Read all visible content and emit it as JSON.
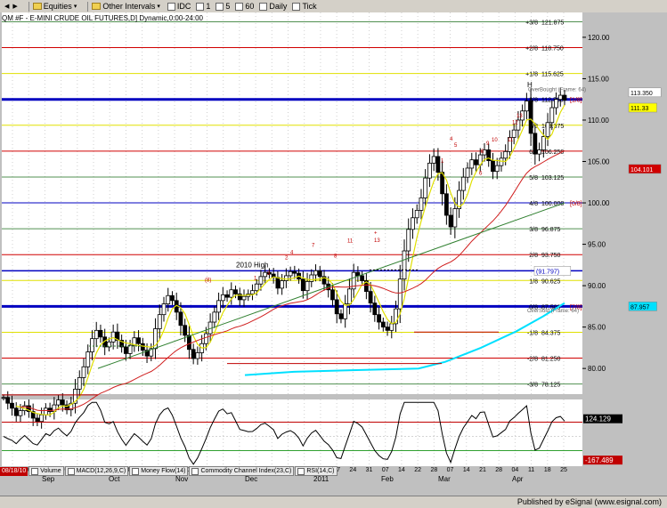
{
  "toolbar": {
    "items": [
      "Equities",
      "Other Intervals",
      "IDC",
      "1",
      "5",
      "60",
      "Daily",
      "Tick"
    ]
  },
  "chart_title": "QM #F - E-MINI CRUDE OIL FUTURES,D] Dynamic,0:00-24:00",
  "colors": {
    "background": "#ffffff",
    "axis_panel": "#c0c0c0",
    "up_bar": "#000000",
    "down_bar": "#000000",
    "ma_yellow": "#e0e000",
    "ma_red": "#d02020",
    "ma_green": "#308030",
    "ma_cyan": "#00e0ff",
    "murray_red": "#d00000",
    "murray_blue": "#0000c0",
    "murray_yellow": "#e0e000",
    "murray_green": "#509050"
  },
  "chart_data": [
    {
      "type": "line",
      "title": "",
      "ylim": [
        76.9,
        123
      ],
      "y_ticks": [
        80.0,
        85.0,
        90.0,
        95.0,
        100.0,
        105.0,
        110.0,
        115.0,
        120.0
      ],
      "x_months": [
        "Sep",
        "Oct",
        "Nov",
        "Dec",
        "2011",
        "Feb",
        "Mar",
        "Apr"
      ],
      "x_ticks": [
        "30",
        "07",
        "13",
        "20",
        "27",
        "04",
        "11",
        "18",
        "25",
        "01",
        "08",
        "15",
        "22",
        "29",
        "06",
        "13",
        "20",
        "27",
        "03",
        "10",
        "17",
        "24",
        "31",
        "07",
        "14",
        "22",
        "28",
        "07",
        "14",
        "21",
        "28",
        "04",
        "11",
        "18",
        "25"
      ],
      "murray_levels": [
        {
          "label": "+3/8",
          "value": 121.875
        },
        {
          "label": "+2/8",
          "value": 118.75
        },
        {
          "label": "+1/8",
          "value": 115.625
        },
        {
          "label": "8/8",
          "value": 112.5,
          "suffix": "[1/8]"
        },
        {
          "label": "7/8",
          "value": 109.375
        },
        {
          "label": "6/8",
          "value": 106.25
        },
        {
          "label": "5/8",
          "value": 103.125
        },
        {
          "label": "4/8",
          "value": 100.0,
          "suffix": "[0/8]"
        },
        {
          "label": "3/8",
          "value": 96.875
        },
        {
          "label": "2/8",
          "value": 93.75
        },
        {
          "label": "1/8",
          "value": 90.625
        },
        {
          "label": "0/8",
          "value": 87.5,
          "suffix": "[7/8]"
        },
        {
          "label": "-1/8",
          "value": 84.375
        },
        {
          "label": "-2/8",
          "value": 81.25
        },
        {
          "label": "-3/8",
          "value": 78.125
        }
      ],
      "close_series": [
        76.5,
        75.8,
        75.2,
        74.3,
        74.9,
        75.5,
        74.8,
        74.0,
        73.6,
        74.4,
        75.2,
        74.8,
        75.6,
        76.2,
        75.6,
        75.0,
        75.8,
        77.5,
        78.9,
        80.2,
        82.0,
        83.6,
        84.6,
        83.8,
        82.6,
        83.2,
        84.4,
        83.4,
        82.6,
        81.8,
        82.8,
        83.7,
        83.0,
        82.2,
        81.5,
        82.4,
        84.8,
        86.5,
        87.8,
        88.8,
        88.2,
        86.8,
        85.2,
        84.0,
        82.3,
        81.2,
        81.9,
        83.0,
        84.2,
        85.6,
        86.8,
        88.2,
        88.9,
        88.6,
        89.5,
        89.0,
        88.3,
        88.7,
        89.0,
        89.4,
        90.2,
        91.1,
        91.6,
        91.4,
        91.0,
        89.7,
        90.6,
        91.2,
        91.7,
        91.5,
        90.8,
        89.4,
        90.5,
        91.3,
        91.8,
        91.1,
        90.2,
        89.5,
        88.3,
        86.6,
        86.0,
        87.8,
        89.6,
        91.6,
        91.2,
        90.6,
        89.3,
        87.9,
        86.5,
        85.6,
        85.0,
        84.6,
        85.4,
        87.2,
        90.8,
        94.2,
        96.8,
        98.2,
        99.1,
        100.6,
        103.0,
        104.8,
        105.6,
        103.7,
        101.1,
        98.5,
        97.1,
        99.3,
        101.5,
        103.1,
        104.2,
        105.2,
        104.6,
        105.8,
        106.4,
        105.1,
        103.8,
        104.5,
        105.4,
        106.2,
        107.9,
        108.8,
        110.0,
        111.1,
        112.3,
        108.4,
        105.9,
        106.4,
        108.0,
        109.7,
        111.5,
        112.5,
        113.0,
        112.4
      ],
      "annotations": [
        {
          "text": "2010 High",
          "value": 91.797
        },
        {
          "text": "OverBought (Frame: 64)"
        },
        {
          "text": "OverSold (Frame: 64)"
        },
        {
          "text": "H"
        },
        {
          "text": "4"
        },
        {
          "text": "5"
        },
        {
          "text": "7"
        },
        {
          "text": "8"
        },
        {
          "text": "9"
        },
        {
          "text": "10"
        },
        {
          "text": "11"
        },
        {
          "text": "12"
        },
        {
          "text": "13"
        },
        {
          "text": "6"
        },
        {
          "text": "3"
        },
        {
          "text": "2"
        },
        {
          "text": "1"
        },
        {
          "text": "(8)"
        },
        {
          "text": "+"
        }
      ],
      "price_flags": [
        {
          "text": "113.350",
          "value": 113.35,
          "bg": "#ffffff",
          "fg": "#000000"
        },
        {
          "text": "111.33",
          "value": 111.5,
          "bg": "#ffff00",
          "fg": "#000000"
        },
        {
          "text": "104.101",
          "value": 104.1,
          "bg": "#d00000",
          "fg": "#ffffff"
        },
        {
          "text": "(91.797)",
          "value": 91.797,
          "bg": "#ffffff",
          "fg": "#0000c0"
        },
        {
          "text": "87.957",
          "value": 87.5,
          "bg": "#00e0ff",
          "fg": "#000000"
        }
      ]
    },
    {
      "type": "line",
      "title": "Commodity Channel Index(23,C)",
      "y_labels": [
        "124.129",
        "-167.489"
      ],
      "bands": [
        100,
        -100
      ]
    }
  ],
  "indicator_tabs": {
    "date": "08/18/10",
    "tabs": [
      "Volume",
      "MACD(12,26,9,C)",
      "Money Flow(14)",
      "Commodity Channel Index(23,C)",
      "RSI(14,C)"
    ]
  },
  "status_text": "Published by eSignal (www.esignal.com)"
}
